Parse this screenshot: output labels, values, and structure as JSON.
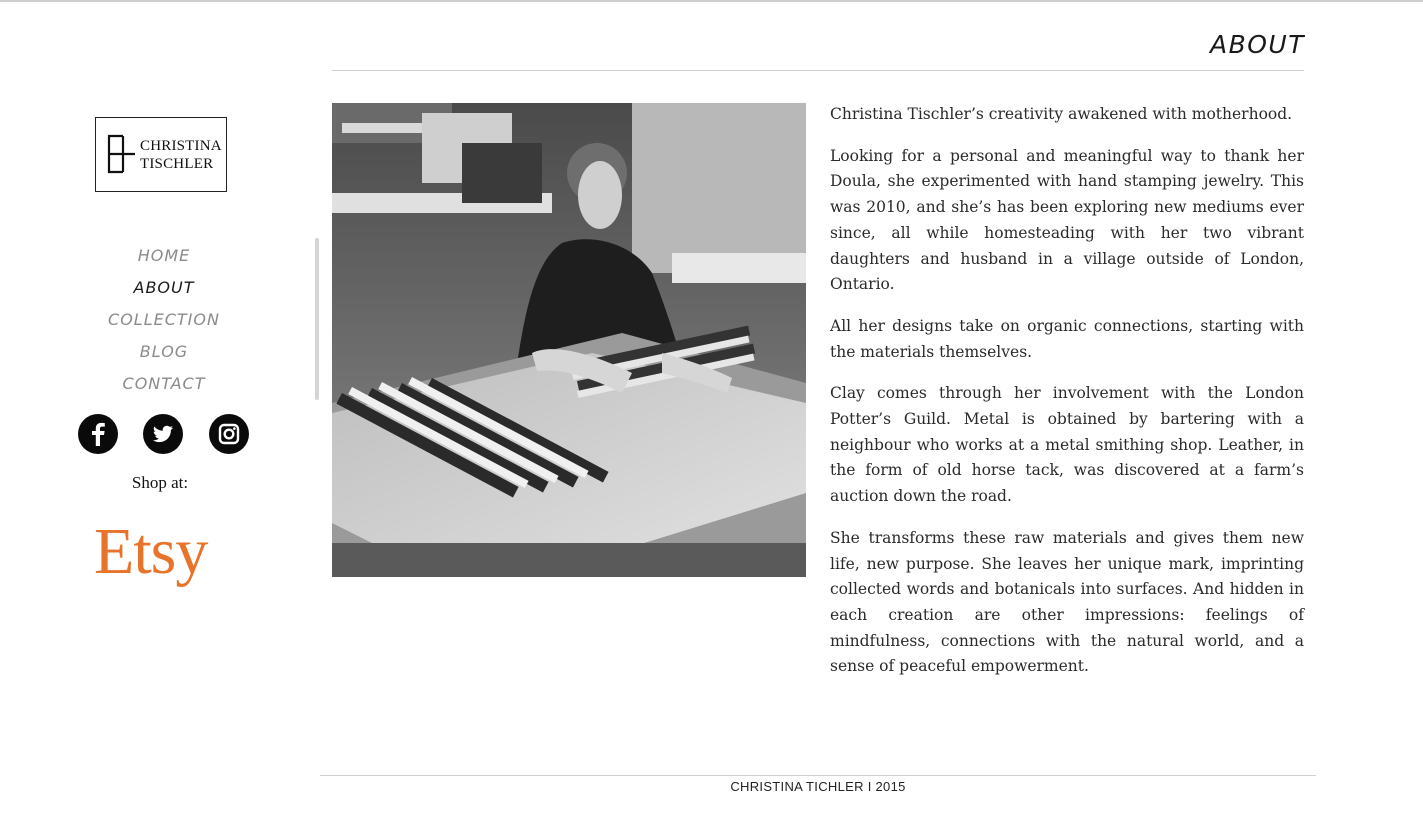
{
  "brand": {
    "logo_line1": "CHRISTINA",
    "logo_line2": "TISCHLER"
  },
  "nav": {
    "items": [
      {
        "label": "HOME",
        "active": false
      },
      {
        "label": "ABOUT",
        "active": true
      },
      {
        "label": "COLLECTION",
        "active": false
      },
      {
        "label": "BLOG",
        "active": false
      },
      {
        "label": "CONTACT",
        "active": false
      }
    ]
  },
  "social": {
    "icons": [
      "facebook-icon",
      "twitter-icon",
      "instagram-icon"
    ]
  },
  "shop": {
    "label": "Shop at:",
    "store": "Etsy",
    "store_color": "#e8742c"
  },
  "page": {
    "title": "ABOUT"
  },
  "bio": {
    "paragraphs": [
      "Christina Tischler’s creativity awakened with motherhood.",
      "Looking for a personal and meaningful way to thank her Doula, she experimented with hand stamping jewelry. This was 2010, and she’s has been exploring new mediums ever since, all while homesteading with her two vibrant daughters and husband in a village outside of London, Ontario.",
      "All her designs take on organic connections, starting with the materials themselves.",
      "Clay comes through her involvement with the London Potter’s Guild. Metal is obtained by bartering with a neighbour who works at a metal smithing shop. Leather, in the form of old horse tack, was discovered at a farm’s auction down the road.",
      "She transforms these raw materials and gives them new life, new purpose. She leaves her unique mark, imprinting collected words and botanicals into surfaces. And hidden in each creation are other impressions: feelings of mindfulness, connections with the natural world, and a sense of peaceful empowerment."
    ]
  },
  "footer": {
    "text": "CHRISTINA TICHLER I 2015"
  }
}
